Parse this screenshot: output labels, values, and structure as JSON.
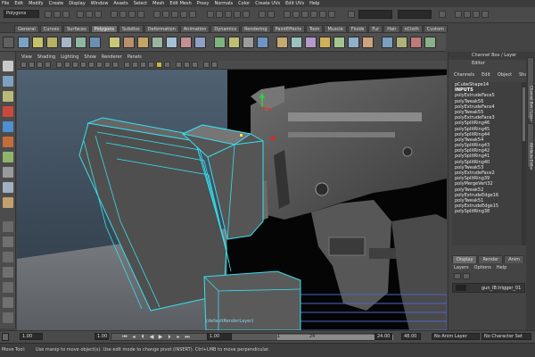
{
  "menubar": {
    "items": [
      "File",
      "Edit",
      "Modify",
      "Create",
      "Display",
      "Window",
      "Assets",
      "Select",
      "Mesh",
      "Edit Mesh",
      "Proxy",
      "Normals",
      "Color",
      "Create UVs",
      "Edit UVs",
      "Help"
    ]
  },
  "status_line": {
    "mode": "Polygons"
  },
  "shelf": {
    "tabs": [
      "General",
      "Curves",
      "Surfaces",
      "Polygons",
      "Subdivs",
      "Deformation",
      "Animation",
      "Dynamics",
      "Rendering",
      "PaintEffects",
      "Toon",
      "Muscle",
      "Fluids",
      "Fur",
      "Hair",
      "nCloth",
      "Custom"
    ],
    "active_tab": "Polygons"
  },
  "panel": {
    "menus": [
      "View",
      "Shading",
      "Lighting",
      "Show",
      "Renderer",
      "Panels"
    ]
  },
  "viewport": {
    "layer_tag": "(defaultRenderLayer)",
    "colors": {
      "sky": "#3e4d5e",
      "floor": "#6a6e72",
      "wire": "#35e0ef",
      "mesh": "#5b5b5b",
      "ref_bg": "#000000"
    }
  },
  "channel_box": {
    "title": "Channel Box / Layer Editor",
    "menus": [
      "Channels",
      "Edit",
      "Object",
      "Show"
    ],
    "node": "pCubeShape14",
    "inputs_label": "INPUTS",
    "history": [
      "polyExtrudeFace5",
      "polyTweak56",
      "polyExtrudeFace4",
      "polyTweak55",
      "polyExtrudeFace3",
      "polySplitRing46",
      "polySplitRing45",
      "polySplitRing44",
      "polyTweak54",
      "polySplitRing43",
      "polySplitRing42",
      "polySplitRing41",
      "polySplitRing40",
      "polyTweak53",
      "polyExtrudeFace2",
      "polySplitRing39",
      "polyMergeVert32",
      "polyTweak52",
      "polyExtrudeEdge16",
      "polyTweak51",
      "polyExtrudeEdge15",
      "polySplitRing38"
    ]
  },
  "layer_editor": {
    "tabs": [
      "Display",
      "Render",
      "Anim"
    ],
    "active_tab": "Display",
    "menus": [
      "Layers",
      "Options",
      "Help"
    ],
    "layer_name": "gun_lB:trigger_01"
  },
  "side_tabs": [
    "Channel Box / Layer Editor",
    "Attribute Editor"
  ],
  "time_slider": {
    "start": "1.00",
    "current": "1.00",
    "range_start_field": "1.00",
    "range_start": "1",
    "range_end": "24",
    "end": "24.00",
    "end_total": "48.00",
    "anim_layer": "No Anim Layer",
    "char_set": "No Character Set"
  },
  "help_line": {
    "label": "Move Tool:",
    "text": "Use manip to move object(s). Use edit mode to change pivot (INSERT). Ctrl+LMB to move perpendicular."
  }
}
